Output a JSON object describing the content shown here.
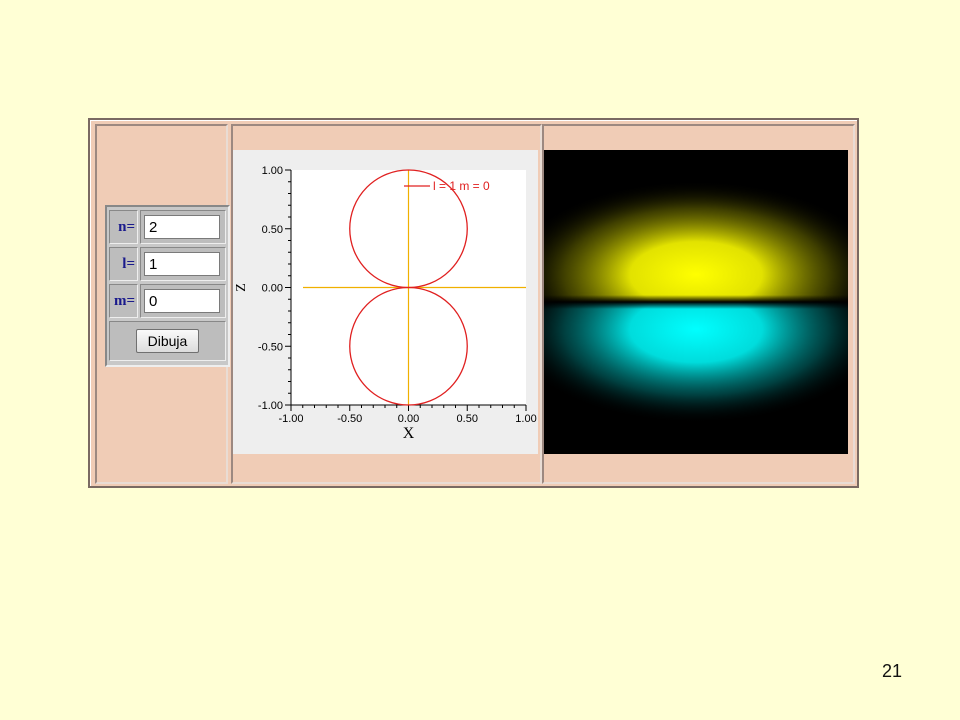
{
  "controls": {
    "n_label": "n=",
    "n_value": "2",
    "l_label": "l=",
    "l_value": "1",
    "m_label": "m=",
    "m_value": "0",
    "draw_button": "Dibuja"
  },
  "chart_data": {
    "type": "line",
    "xlabel": "X",
    "ylabel": "Z",
    "xlim": [
      -1.0,
      1.0
    ],
    "ylim": [
      -1.0,
      1.0
    ],
    "x_ticks": [
      "-1.00",
      "-0.50",
      "0.00",
      "0.50",
      "1.00"
    ],
    "y_ticks": [
      "1.00",
      "0.50",
      "0.00",
      "-0.50",
      "-1.00"
    ],
    "legend": "l = 1 m = 0",
    "legend_position": "top-right",
    "grid": false,
    "series": [
      {
        "name": "l = 1 m = 0",
        "color": "#E02020",
        "shape": "polar |cos θ|, two lobes",
        "lobes": [
          {
            "center_x": 0.0,
            "center_z": 0.5,
            "radius": 0.5
          },
          {
            "center_x": 0.0,
            "center_z": -0.5,
            "radius": 0.5
          }
        ]
      }
    ],
    "axes_color": "#F0B000"
  },
  "orbital_image": {
    "upper_lobe_color": "#FFFF00",
    "lower_lobe_color": "#00FFFF",
    "background_color": "#000000"
  },
  "slide_number": "21"
}
